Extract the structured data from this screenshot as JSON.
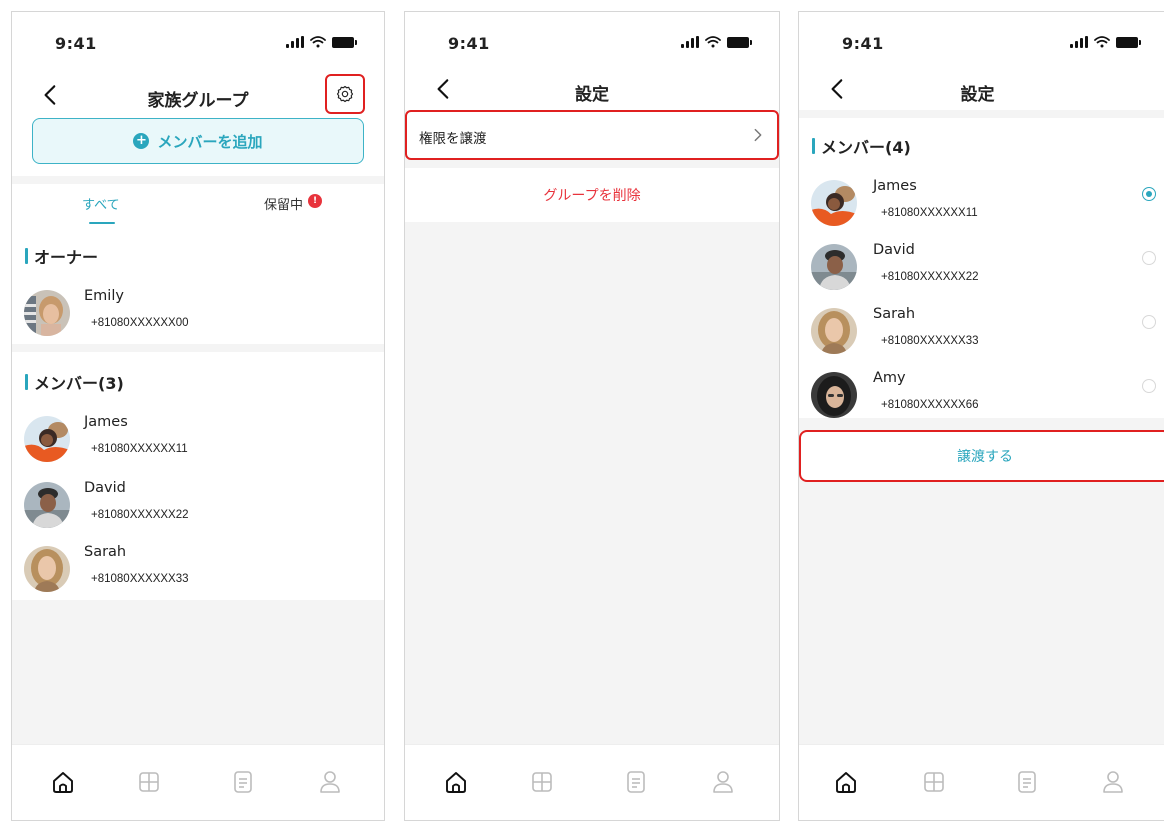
{
  "status_bar": {
    "time": "9:41"
  },
  "screen1": {
    "title": "家族グループ",
    "add_member_label": "メンバーを追加",
    "tabs": [
      {
        "label": "すべて",
        "active": true
      },
      {
        "label": "保留中",
        "active": false
      }
    ],
    "badge": "!",
    "owner_section": "オーナー",
    "owner": {
      "name": "Emily",
      "phone": "+81080XXXXXX00"
    },
    "member_section": "メンバー(3)",
    "members": [
      {
        "name": "James",
        "phone": "+81080XXXXXX11"
      },
      {
        "name": "David",
        "phone": "+81080XXXXXX22"
      },
      {
        "name": "Sarah",
        "phone": "+81080XXXXXX33"
      }
    ]
  },
  "screen2": {
    "title": "設定",
    "transfer_label": "権限を譲渡",
    "delete_label": "グループを削除"
  },
  "screen3": {
    "title": "設定",
    "member_section": "メンバー(4)",
    "members": [
      {
        "name": "James",
        "phone": "+81080XXXXXX11",
        "selected": true
      },
      {
        "name": "David",
        "phone": "+81080XXXXXX22",
        "selected": false
      },
      {
        "name": "Sarah",
        "phone": "+81080XXXXXX33",
        "selected": false
      },
      {
        "name": "Amy",
        "phone": "+81080XXXXXX66",
        "selected": false
      }
    ],
    "confirm_label": "譲渡する"
  },
  "tabbar_icons": [
    "home-icon",
    "grid-icon",
    "document-icon",
    "profile-icon"
  ],
  "colors": {
    "accent": "#2aa6bd",
    "highlight": "#e02020",
    "danger": "#e8333c",
    "background": "#f4f4f4"
  }
}
